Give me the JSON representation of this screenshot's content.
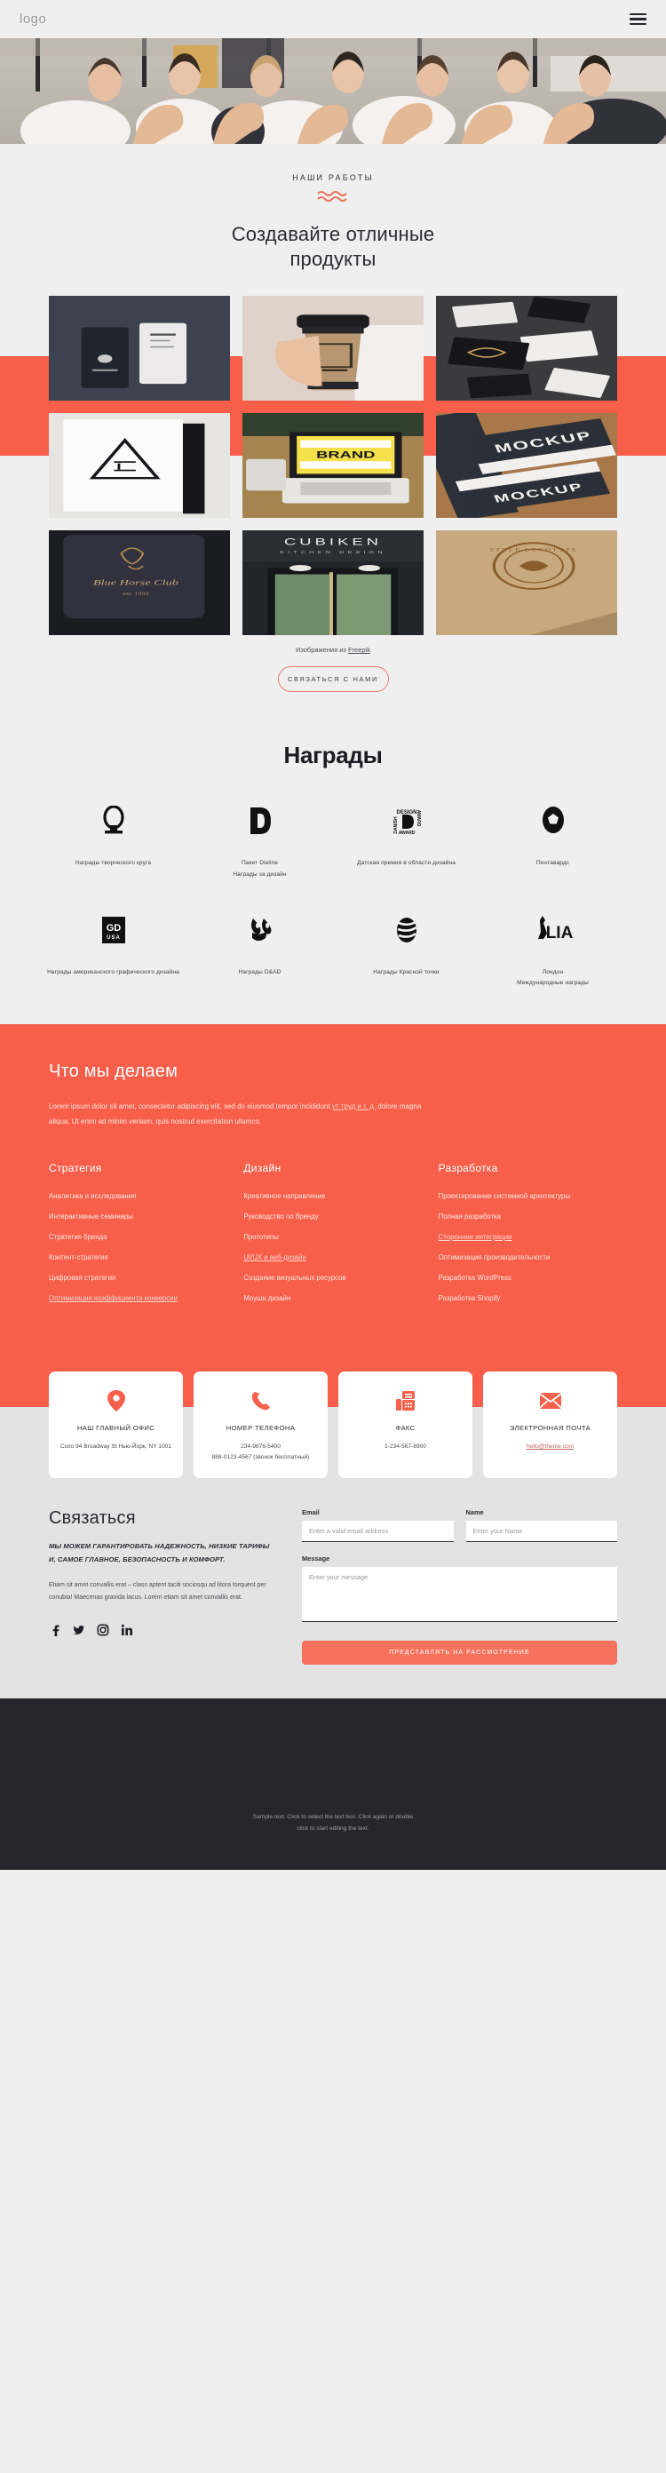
{
  "header": {
    "logo": "logo",
    "menu_icon": "hamburger-icon"
  },
  "hero": {
    "alt": "team-thumbs-up-photo"
  },
  "works": {
    "eyebrow": "НАШИ РАБОТЫ",
    "title": "Создавайте отличные продукты",
    "credit_prefix": "Изображения из ",
    "credit_link": "Freepik",
    "cta": "СВЯЗАТЬСЯ С НАМИ",
    "tiles": [
      {
        "name": "dark-stationery-mockup"
      },
      {
        "name": "coffee-cup-branding"
      },
      {
        "name": "black-business-cards"
      },
      {
        "name": "minimal-book-cover"
      },
      {
        "name": "laptop-branding-strategy"
      },
      {
        "name": "business-card-mockup"
      },
      {
        "name": "blue-horse-club-folder"
      },
      {
        "name": "cubiken-storefront"
      },
      {
        "name": "kraft-envelope-logotype"
      }
    ]
  },
  "awards": {
    "title": "Награды",
    "items": [
      {
        "logo": "creative-circle-icon",
        "label": "Награды творческого круга"
      },
      {
        "logo": "dieline-d-icon",
        "label": "Пакет Dieline\nНаграды за дизайн"
      },
      {
        "logo": "danish-design-award-icon",
        "label": "Датская премия в области дизайна"
      },
      {
        "logo": "pentawards-icon",
        "label": "Пентавардс"
      },
      {
        "logo": "gdusa-icon",
        "label": "Награды американского графического дизайна"
      },
      {
        "logo": "dad-pencil-icon",
        "label": "Награды D&AD"
      },
      {
        "logo": "red-dot-icon",
        "label": "Награды Красной точки"
      },
      {
        "logo": "lia-icon",
        "label": "Лондон\nМеждународные награды"
      }
    ]
  },
  "what_we_do": {
    "title": "Что мы делаем",
    "lead_part1": "Lorem ipsum dolor sit amet, consectetur adipiscing elit, sed do eiusmod tempor incididunt ",
    "lead_link": "ут труд и т. д.",
    "lead_part2": " dolore magna aliqua. Ut enim ad minim veniam, quis nostrud exercitation ullamco.",
    "columns": [
      {
        "title": "Стратегия",
        "items": [
          {
            "label": "Аналитика и исследования",
            "highlight": false
          },
          {
            "label": "Интерактивные семинары",
            "highlight": false
          },
          {
            "label": "Стратегия бренда",
            "highlight": false
          },
          {
            "label": "Контент-стратегия",
            "highlight": false
          },
          {
            "label": "Цифровая стратегия",
            "highlight": false
          },
          {
            "label": "Оптимизация коэффициента конверсии",
            "highlight": true
          }
        ]
      },
      {
        "title": "Дизайн",
        "items": [
          {
            "label": "Креативное направление",
            "highlight": false
          },
          {
            "label": "Руководство по бренду",
            "highlight": false
          },
          {
            "label": "Прототипы",
            "highlight": false
          },
          {
            "label": "UI/UX и веб-дизайн",
            "highlight": true
          },
          {
            "label": "Создание визуальных ресурсов",
            "highlight": false
          },
          {
            "label": "Моушн дизайн",
            "highlight": false
          }
        ]
      },
      {
        "title": "Разработка",
        "items": [
          {
            "label": "Проектирование системной архитектуры",
            "highlight": false
          },
          {
            "label": "Полная разработка",
            "highlight": false
          },
          {
            "label": "Сторонние интеграции",
            "highlight": true
          },
          {
            "label": "Оптимизация производительности",
            "highlight": false
          },
          {
            "label": "Разработка WordPress",
            "highlight": false
          },
          {
            "label": "Разработка Shopify",
            "highlight": false
          }
        ]
      }
    ]
  },
  "contact_cards": [
    {
      "icon": "location-pin-icon",
      "title": "НАШ ГЛАВНЫЙ ОФИС",
      "lines": [
        "Сохо 94 Broadway St Нью-Йорк, NY 1001"
      ],
      "link": ""
    },
    {
      "icon": "phone-icon",
      "title": "НОМЕР ТЕЛЕФОНА",
      "lines": [
        "234-9876-5400",
        "888-0123-4567 (звонок бесплатный)"
      ],
      "link": ""
    },
    {
      "icon": "fax-icon",
      "title": "ФАКС",
      "lines": [
        "1-234-567-8900"
      ],
      "link": ""
    },
    {
      "icon": "envelope-icon",
      "title": "ЭЛЕКТРОННАЯ ПОЧТА",
      "lines": [],
      "link": "hello@theme.com"
    }
  ],
  "contact": {
    "title": "Связаться",
    "subtitle": "МЫ МОЖЕМ ГАРАНТИРОВАТЬ НАДЕЖНОСТЬ, НИЗКИЕ ТАРИФЫ И, САМОЕ ГЛАВНОЕ, БЕЗОПАСНОСТЬ И КОМФОРТ.",
    "body": "Etiam sit amet convallis erat – class aptent taciti sociosqu ad litora torquent per conubia! Maecenas gravida lacus. Lorem etiam sit amet convallis erat.",
    "socials": [
      "facebook-icon",
      "twitter-icon",
      "instagram-icon",
      "linkedin-icon"
    ],
    "form": {
      "email_label": "Email",
      "email_placeholder": "Enter a valid email address",
      "name_label": "Name",
      "name_placeholder": "Enter your Name",
      "message_label": "Message",
      "message_placeholder": "Enter your message",
      "submit_label": "ПРЕДСТАВЛЯТЬ НА РАССМОТРЕНИЕ"
    }
  },
  "footer": {
    "line1": "Sample text. Click to select the text box. Click again or double",
    "line2": "click to start editing the text."
  },
  "colors": {
    "accent": "#f75f4a",
    "dark": "#26262c",
    "page_bg": "#f0efef",
    "card_bg": "#e3e3e3"
  }
}
